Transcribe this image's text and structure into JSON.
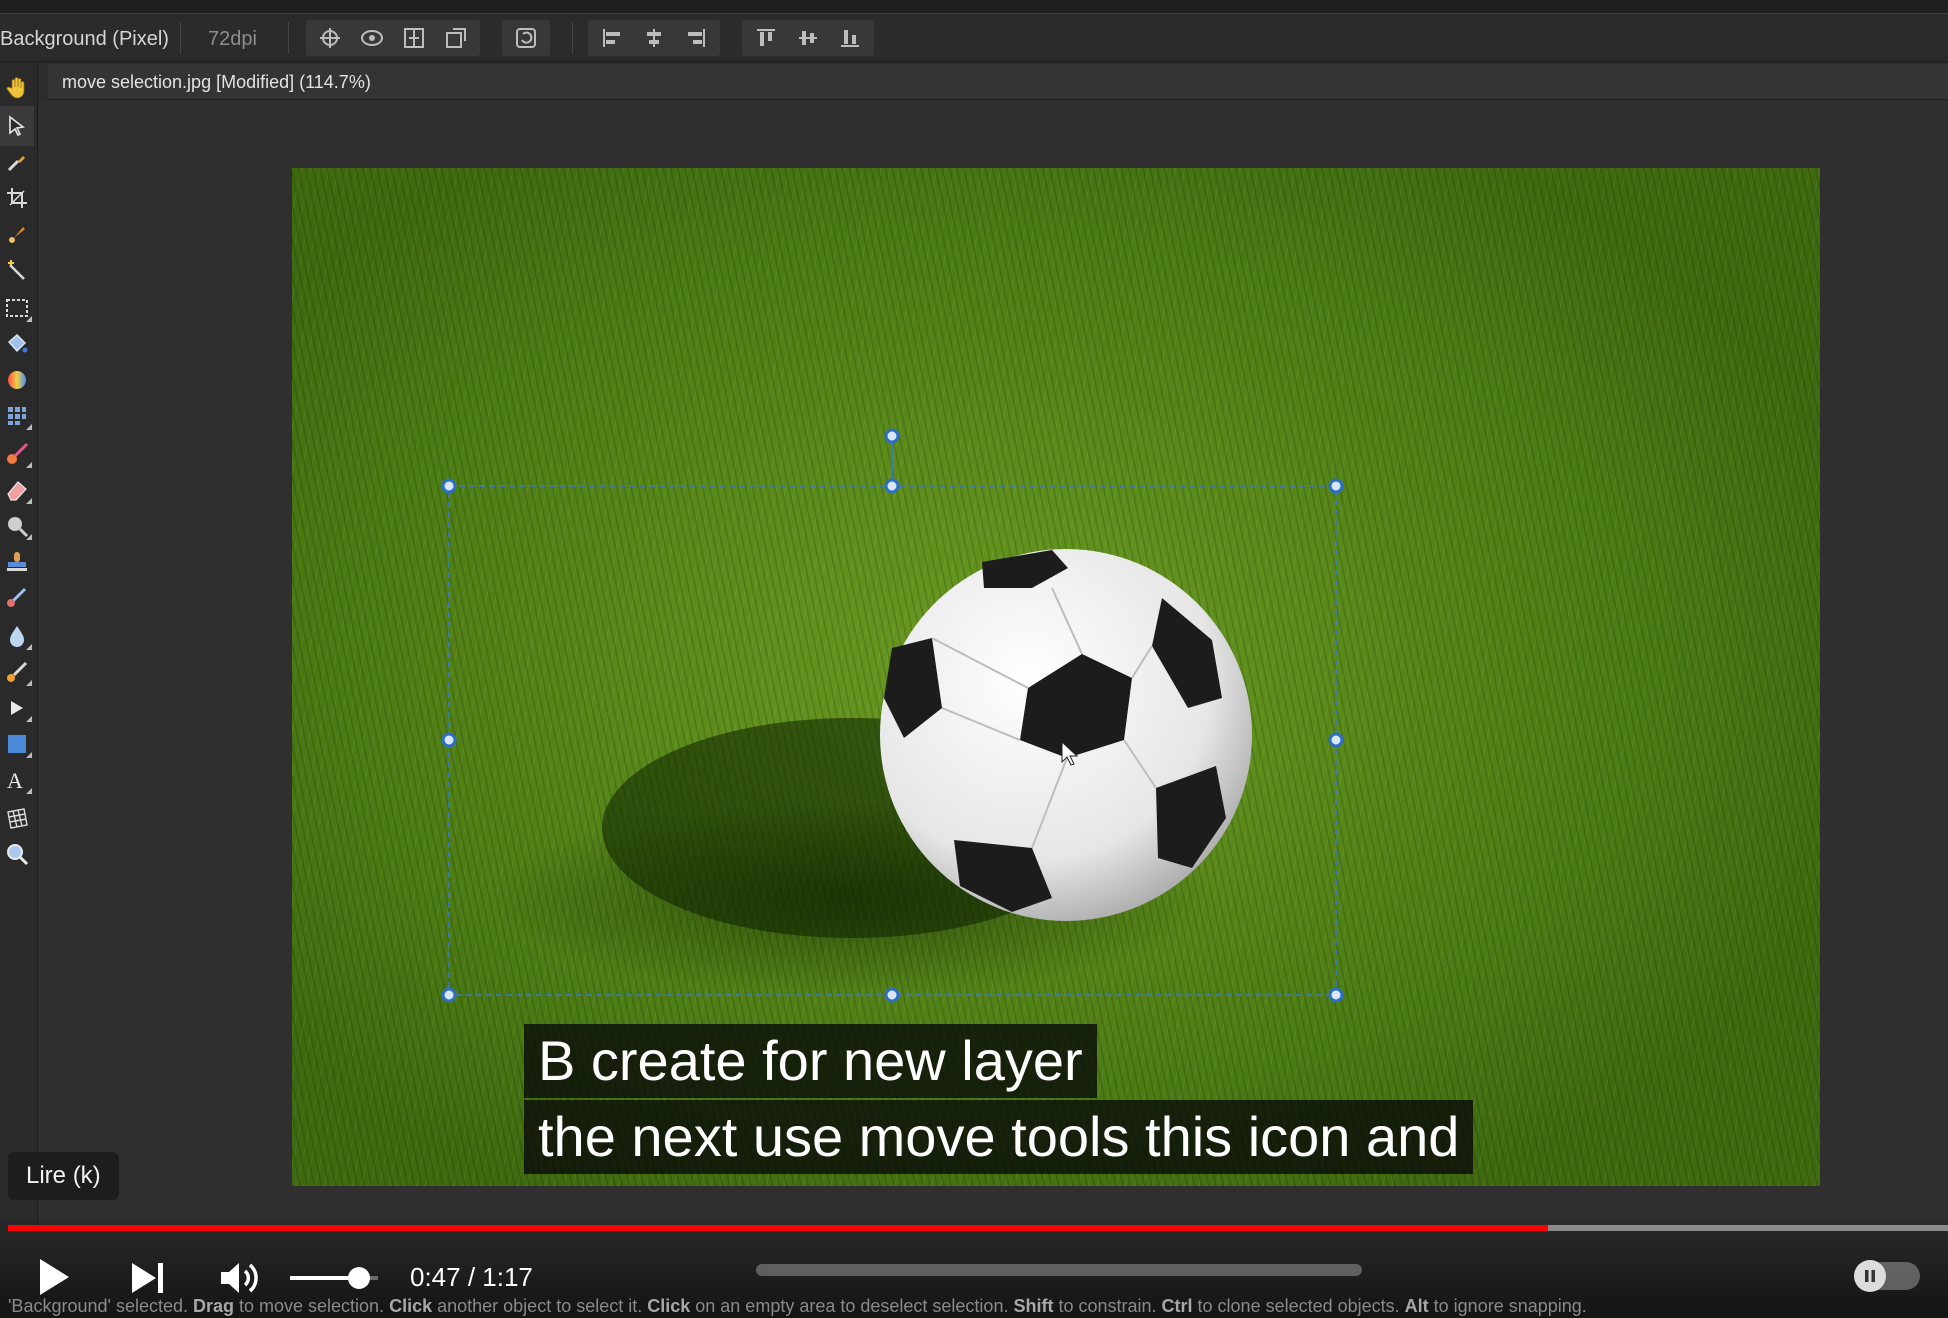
{
  "context_bar": {
    "layer_label": "Background (Pixel)",
    "dpi_label": "72dpi"
  },
  "document": {
    "tab_title": "move selection.jpg [Modified] (114.7%)"
  },
  "tools": [
    {
      "name": "view-tool"
    },
    {
      "name": "move-tool"
    },
    {
      "name": "color-picker-tool"
    },
    {
      "name": "crop-tool"
    },
    {
      "name": "selection-brush-tool"
    },
    {
      "name": "flood-select-tool"
    },
    {
      "name": "marquee-tool"
    },
    {
      "name": "flood-fill-tool"
    },
    {
      "name": "gradient-tool"
    },
    {
      "name": "pattern-tool"
    },
    {
      "name": "paint-brush-tool"
    },
    {
      "name": "erase-brush-tool"
    },
    {
      "name": "dodge-tool"
    },
    {
      "name": "clone-brush-tool"
    },
    {
      "name": "healing-brush-tool"
    },
    {
      "name": "blur-brush-tool"
    },
    {
      "name": "pixel-tool"
    },
    {
      "name": "node-tool"
    },
    {
      "name": "rectangle-tool"
    },
    {
      "name": "text-tool"
    },
    {
      "name": "mesh-warp-tool"
    },
    {
      "name": "zoom-tool"
    }
  ],
  "subtitles": {
    "line1": "B create for new layer",
    "line2": "the next use move tools this icon and"
  },
  "tooltip": {
    "text": "Lire (k)"
  },
  "player": {
    "current_time": "0:47",
    "separator": " / ",
    "duration": "1:17",
    "progress_fraction": 0.794,
    "volume_fraction": 0.78,
    "colors": {
      "progress": "#ff0000",
      "accent": "#ffffff"
    }
  },
  "status_bar": {
    "parts": [
      {
        "text": "'Background' selected. ",
        "bold": false
      },
      {
        "text": "Drag",
        "bold": true
      },
      {
        "text": " to move selection. ",
        "bold": false
      },
      {
        "text": "Click",
        "bold": true
      },
      {
        "text": " another object to select it. ",
        "bold": false
      },
      {
        "text": "Click",
        "bold": true
      },
      {
        "text": " on an empty area to deselect selection. ",
        "bold": false
      },
      {
        "text": "Shift",
        "bold": true
      },
      {
        "text": " to constrain. ",
        "bold": false
      },
      {
        "text": "Ctrl",
        "bold": true
      },
      {
        "text": " to clone selected objects. ",
        "bold": false
      },
      {
        "text": "Alt",
        "bold": true
      },
      {
        "text": " to ignore snapping.",
        "bold": false
      }
    ]
  }
}
